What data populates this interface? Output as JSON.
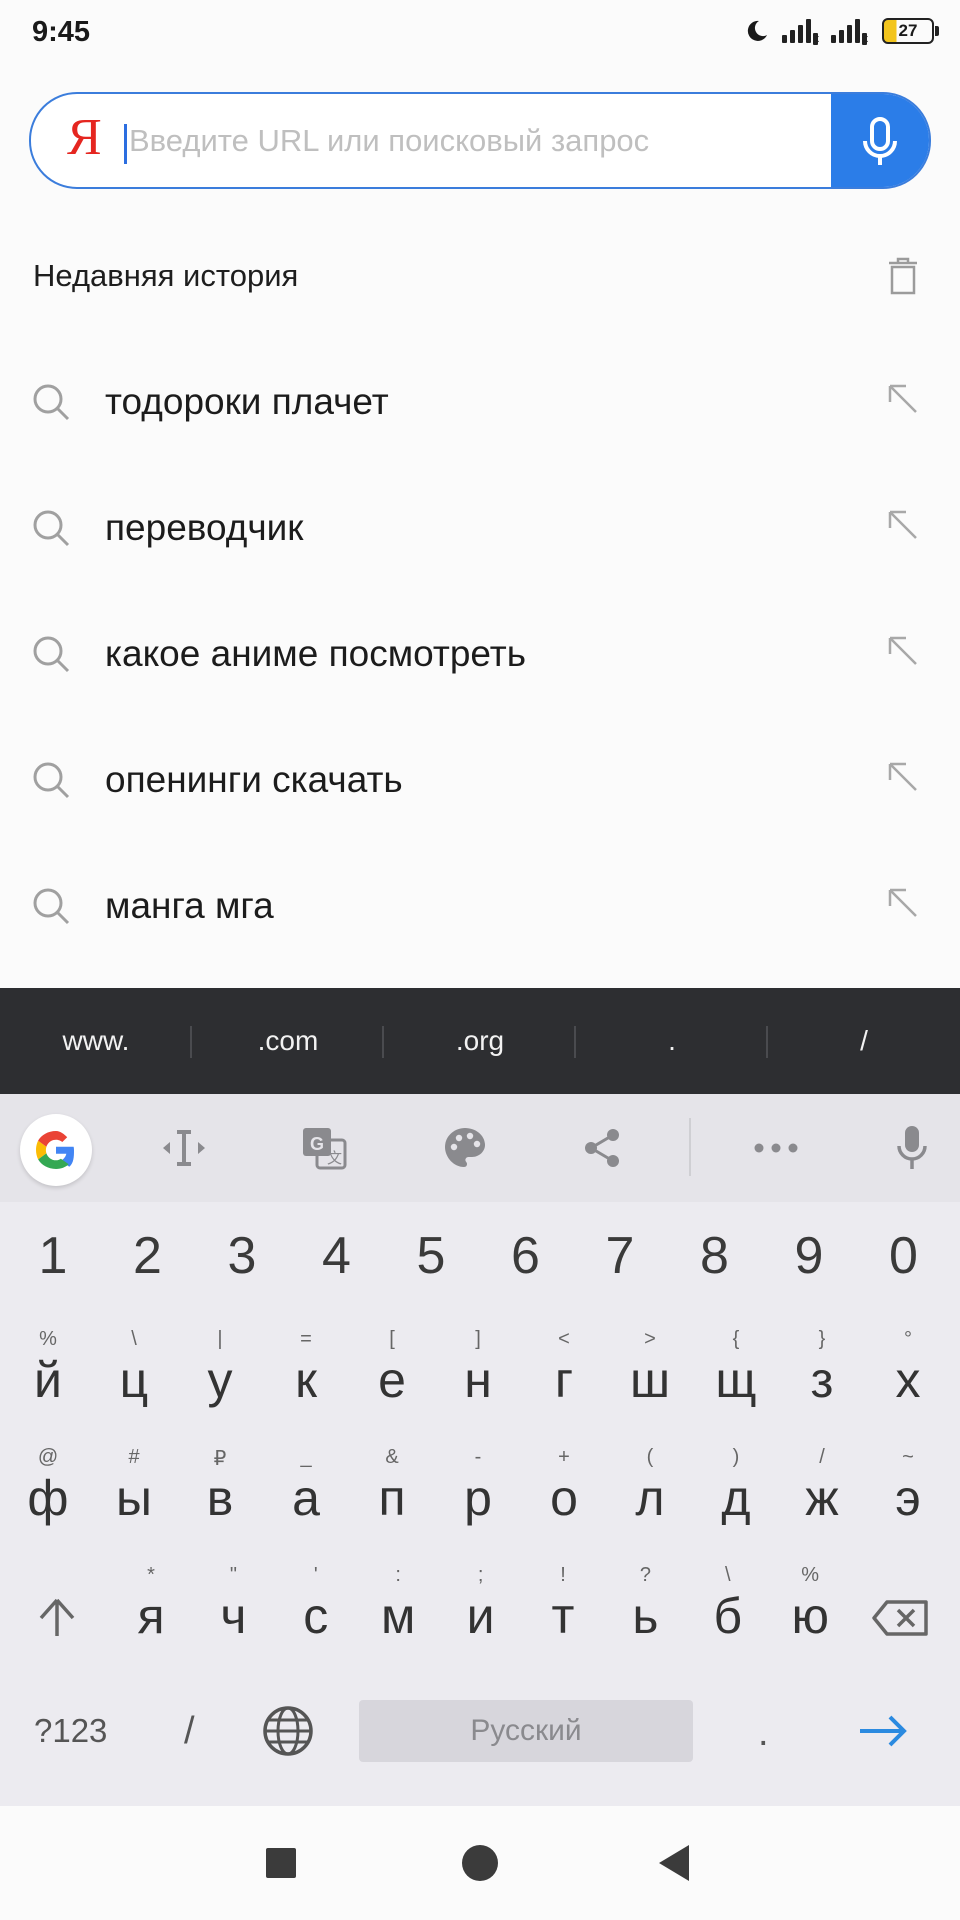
{
  "status_bar": {
    "time": "9:45",
    "battery": "27"
  },
  "search": {
    "logo": "Я",
    "placeholder": "Введите URL или поисковый запрос",
    "value": ""
  },
  "history": {
    "title": "Недавняя история",
    "items": [
      {
        "text": "тодороки плачет"
      },
      {
        "text": "переводчик"
      },
      {
        "text": "какое аниме посмотреть"
      },
      {
        "text": "опенинги скачать"
      },
      {
        "text": "манга мга"
      }
    ]
  },
  "suggestion_strip": [
    "www.",
    ".com",
    ".org",
    ".",
    "/"
  ],
  "keyboard": {
    "digits": [
      "1",
      "2",
      "3",
      "4",
      "5",
      "6",
      "7",
      "8",
      "9",
      "0"
    ],
    "row1": [
      {
        "k": "й",
        "s": "%"
      },
      {
        "k": "ц",
        "s": "\\"
      },
      {
        "k": "у",
        "s": "|"
      },
      {
        "k": "к",
        "s": "="
      },
      {
        "k": "е",
        "s": "["
      },
      {
        "k": "н",
        "s": "]"
      },
      {
        "k": "г",
        "s": "<"
      },
      {
        "k": "ш",
        "s": ">"
      },
      {
        "k": "щ",
        "s": "{"
      },
      {
        "k": "з",
        "s": "}"
      },
      {
        "k": "х",
        "s": "°"
      }
    ],
    "row2": [
      {
        "k": "ф",
        "s": "@"
      },
      {
        "k": "ы",
        "s": "#"
      },
      {
        "k": "в",
        "s": "₽"
      },
      {
        "k": "а",
        "s": "_"
      },
      {
        "k": "п",
        "s": "&"
      },
      {
        "k": "р",
        "s": "-"
      },
      {
        "k": "о",
        "s": "+"
      },
      {
        "k": "л",
        "s": "("
      },
      {
        "k": "д",
        "s": ")"
      },
      {
        "k": "ж",
        "s": "/"
      },
      {
        "k": "э",
        "s": "~"
      }
    ],
    "row3": [
      {
        "k": "я",
        "s": "*"
      },
      {
        "k": "ч",
        "s": "\""
      },
      {
        "k": "с",
        "s": "'"
      },
      {
        "k": "м",
        "s": ":"
      },
      {
        "k": "и",
        "s": ";"
      },
      {
        "k": "т",
        "s": "!"
      },
      {
        "k": "ь",
        "s": "?"
      },
      {
        "k": "б",
        "s": "\\"
      },
      {
        "k": "ю",
        "s": "%"
      }
    ],
    "symbols_key": "?123",
    "slash_key": "/",
    "space_label": "Русский",
    "period_key": "."
  },
  "colors": {
    "accent": "#2b7de8",
    "logo_red": "#e52620",
    "strip_bg": "#2d2e31",
    "keyboard_bg": "#ecebf0"
  },
  "icons": [
    "moon-icon",
    "signal-icon",
    "battery-icon",
    "mic-icon",
    "trash-icon",
    "search-icon",
    "arrow-up-left-icon",
    "google-icon",
    "cursor-icon",
    "translate-icon",
    "palette-icon",
    "share-icon",
    "more-icon",
    "shift-icon",
    "backspace-icon",
    "globe-icon",
    "enter-arrow-icon"
  ]
}
